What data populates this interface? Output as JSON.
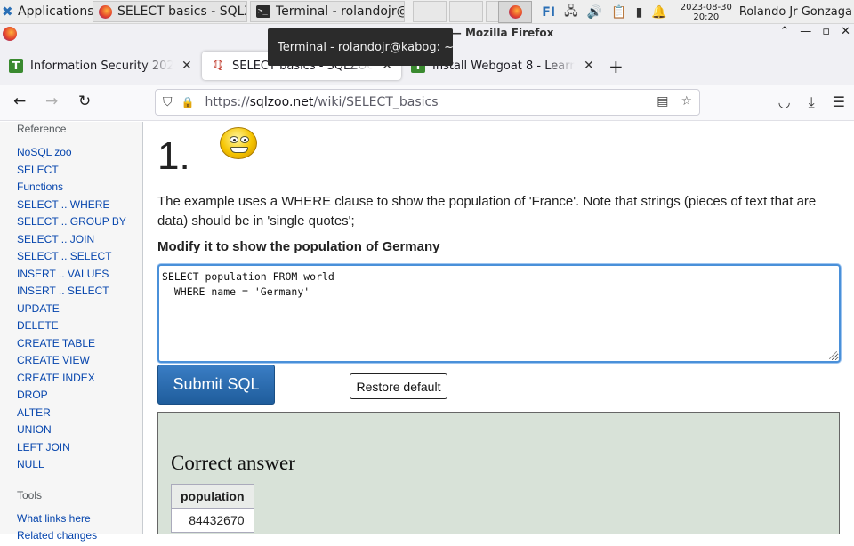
{
  "taskbar": {
    "apps_label": "Applications",
    "tasks": [
      {
        "label": "SELECT basics - SQLZO..."
      },
      {
        "label": "Terminal - rolandojr@..."
      }
    ],
    "tray_fi": "FI",
    "date": "2023-08-30",
    "time": "20:20",
    "user": "Rolando Jr Gonzaga"
  },
  "window": {
    "title": "SELECT basics - SQLZOO — Mozilla Firefox"
  },
  "tooltip": "Terminal - rolandojr@kabog: ~",
  "tabs": [
    {
      "label": "Information Security 2023"
    },
    {
      "label": "SELECT basics - SQLZOO"
    },
    {
      "label": "Install Webgoat 8 - Learn W"
    }
  ],
  "url": {
    "scheme": "https://",
    "host": "sqlzoo.net",
    "path": "/wiki/SELECT_basics"
  },
  "sidebar": {
    "heading": "Reference",
    "links": [
      "NoSQL zoo",
      "SELECT",
      "Functions",
      "SELECT .. WHERE",
      "SELECT .. GROUP BY",
      "SELECT .. JOIN",
      "SELECT .. SELECT",
      "INSERT .. VALUES",
      "INSERT .. SELECT",
      "UPDATE",
      "DELETE",
      "CREATE TABLE",
      "CREATE VIEW",
      "CREATE INDEX",
      "DROP",
      "ALTER",
      "UNION",
      "LEFT JOIN",
      "NULL"
    ],
    "tools_heading": "Tools",
    "tools_links": [
      "What links here",
      "Related changes"
    ]
  },
  "main": {
    "number": "1.",
    "description": "The example uses a WHERE clause to show the population of 'France'. Note that strings (pieces of text that are data) should be in 'single quotes';",
    "instruction": "Modify it to show the population of Germany",
    "sql": "SELECT population FROM world\n  WHERE name = 'Germany'",
    "submit_label": "Submit SQL",
    "restore_label": "Restore default",
    "answer_heading": "Correct answer",
    "result_column": "population",
    "result_value": "84432670"
  }
}
